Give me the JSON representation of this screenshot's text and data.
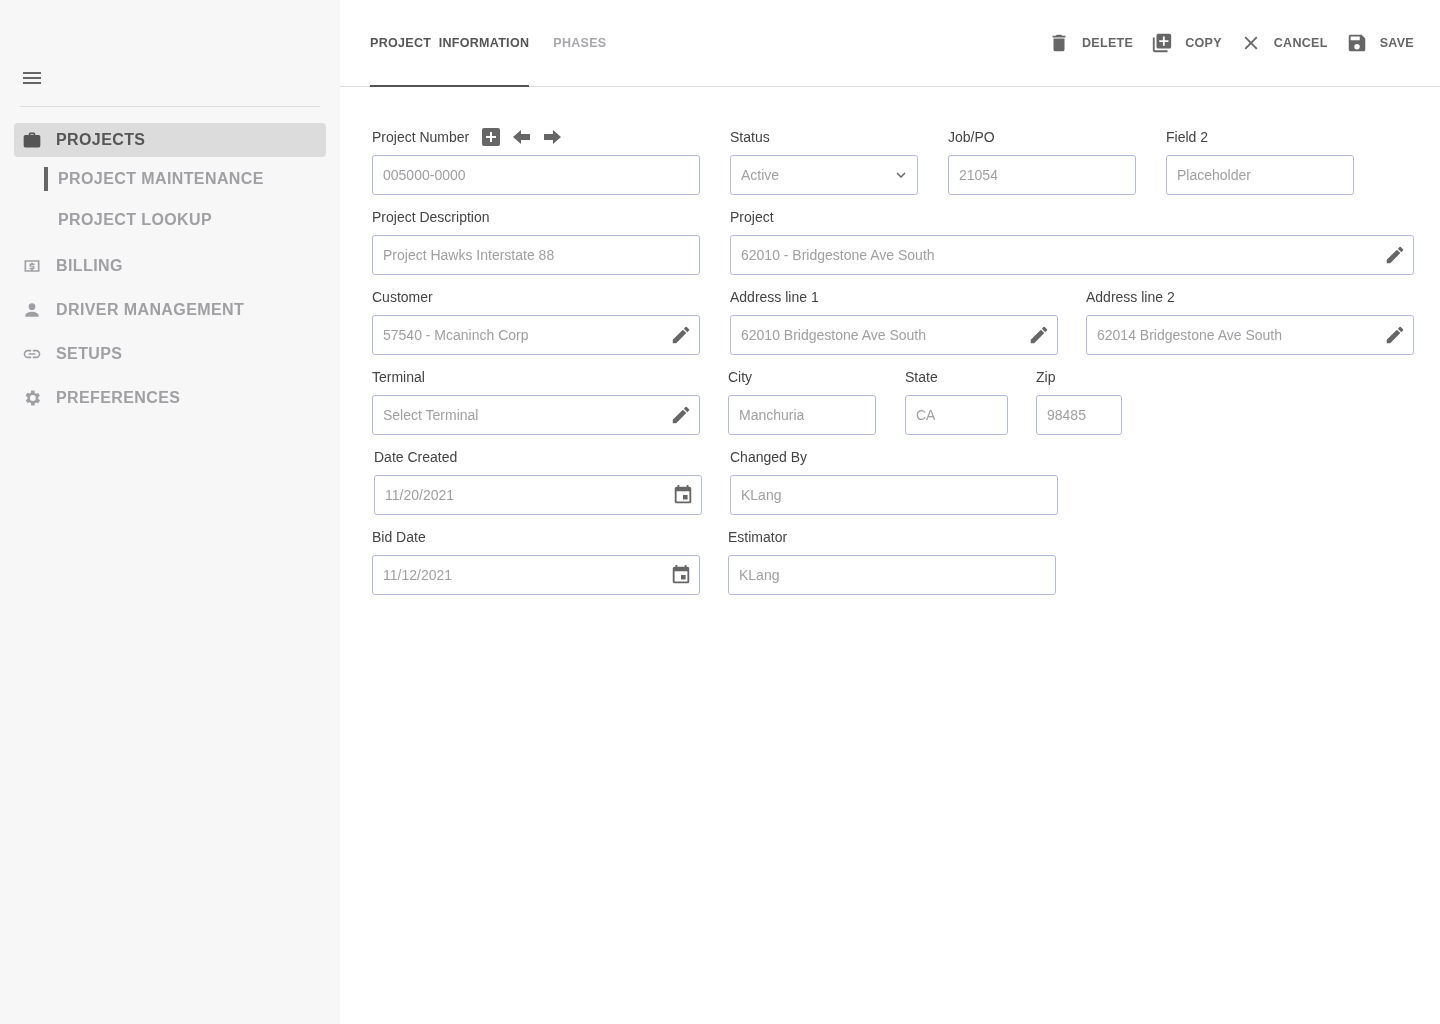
{
  "sidebar": {
    "items": [
      {
        "label": "PROJECTS",
        "selected": true,
        "children": [
          {
            "label": "PROJECT MAINTENANCE",
            "selected": true
          },
          {
            "label": "PROJECT LOOKUP",
            "selected": false
          }
        ]
      },
      {
        "label": "BILLING",
        "selected": false
      },
      {
        "label": "DRIVER MANAGEMENT",
        "selected": false
      },
      {
        "label": "SETUPS",
        "selected": false
      },
      {
        "label": "PREFERENCES",
        "selected": false
      }
    ]
  },
  "tabs": [
    {
      "label": "PROJECT  INFORMATION",
      "selected": true
    },
    {
      "label": "PHASES",
      "selected": false
    }
  ],
  "actions": [
    {
      "label": "DELETE"
    },
    {
      "label": "COPY"
    },
    {
      "label": "CANCEL"
    },
    {
      "label": "SAVE"
    }
  ],
  "form": {
    "rows": [
      [
        {
          "label": "Project Number",
          "kind": "text",
          "value": "005000-0000"
        },
        {
          "label": "Status",
          "kind": "select",
          "value": "Active"
        },
        {
          "label": "Job/PO",
          "kind": "text",
          "value": "21054"
        },
        {
          "label": "Field 2",
          "kind": "text",
          "placeholder": "Placeholder"
        }
      ],
      [
        {
          "label": "Project Description",
          "kind": "text",
          "value": "Project Hawks Interstate 88"
        },
        {
          "label": "Project",
          "kind": "edit",
          "value": "62010 - Bridgestone Ave South"
        }
      ],
      [
        {
          "label": "Customer",
          "kind": "edit",
          "value": "57540 - Mcaninch Corp"
        },
        {
          "label": "Address line 1",
          "kind": "edit",
          "value": "62010 Bridgestone Ave South"
        },
        {
          "label": "Address line 2",
          "kind": "edit",
          "value": "62014 Bridgestone Ave South"
        }
      ],
      [
        {
          "label": "Terminal",
          "kind": "edit",
          "placeholder": "Select Terminal"
        },
        {
          "label": "City",
          "kind": "text",
          "value": "Manchuria"
        },
        {
          "label": "State",
          "kind": "text",
          "value": "CA"
        },
        {
          "label": "Zip",
          "kind": "text",
          "value": "98485"
        }
      ],
      [
        {
          "label": "Date Created",
          "kind": "date",
          "value": "11/20/2021"
        },
        {
          "label": "Changed By",
          "kind": "text",
          "value": "KLang"
        }
      ],
      [
        {
          "label": "Bid Date",
          "kind": "date",
          "value": "11/12/2021"
        },
        {
          "label": "Estimator",
          "kind": "text",
          "value": "KLang"
        }
      ]
    ]
  }
}
